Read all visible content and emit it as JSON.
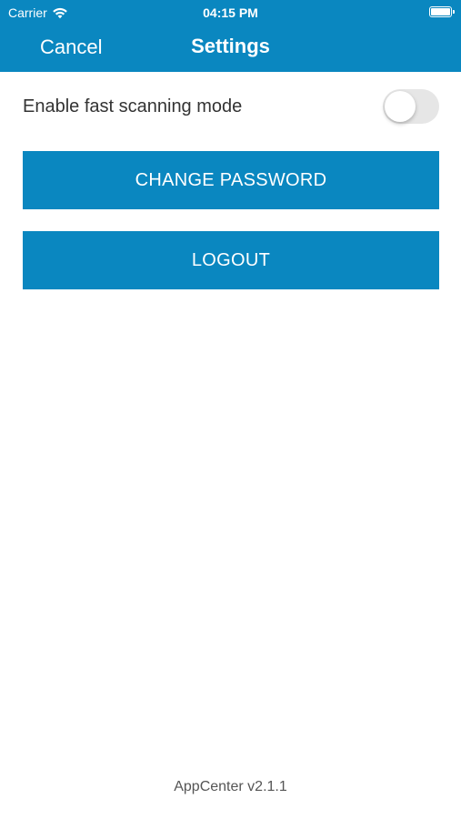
{
  "status_bar": {
    "carrier": "Carrier",
    "time": "04:15 PM",
    "icons": [
      "wifi-icon",
      "battery-icon"
    ]
  },
  "nav": {
    "cancel_label": "Cancel",
    "title": "Settings"
  },
  "settings": {
    "fast_scanning_label": "Enable fast scanning mode",
    "fast_scanning_enabled": false
  },
  "buttons": {
    "change_password_label": "CHANGE PASSWORD",
    "logout_label": "LOGOUT"
  },
  "footer": {
    "version": "AppCenter v2.1.1"
  },
  "colors": {
    "accent": "#0a87c0",
    "background": "#ffffff",
    "toggle_off": "#e6e6e6"
  }
}
